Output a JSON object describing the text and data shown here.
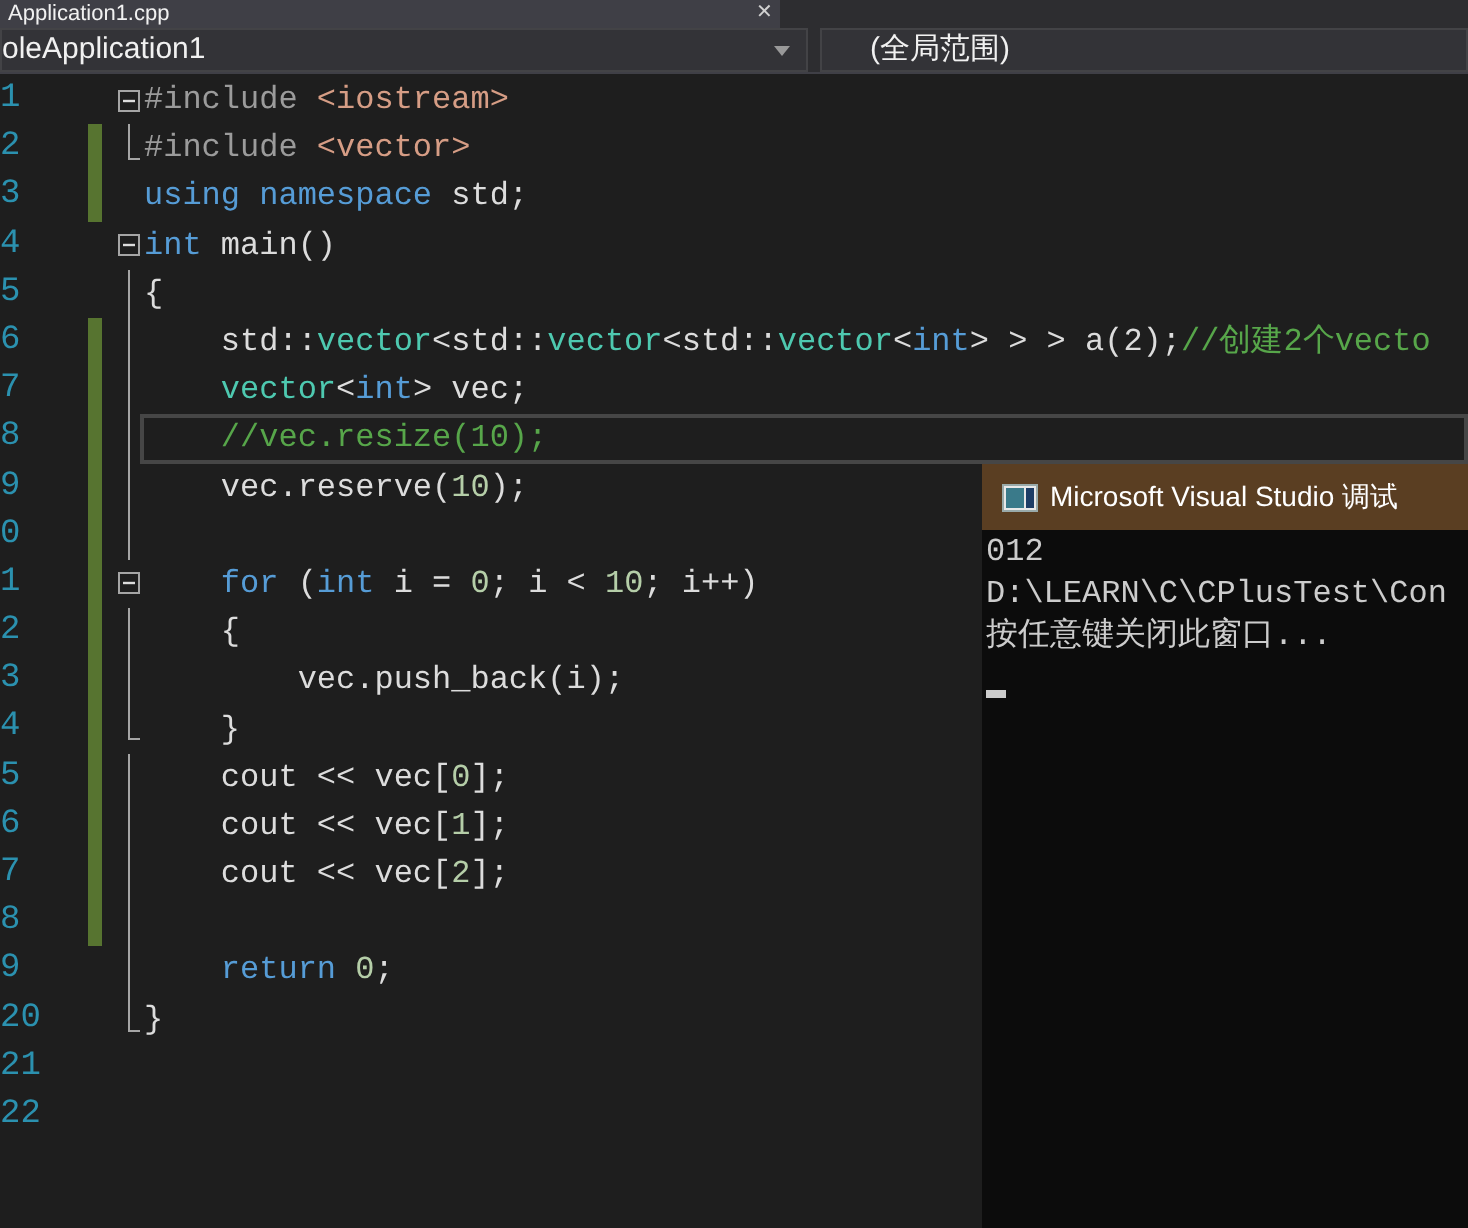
{
  "tab": {
    "title": "Application1.cpp",
    "close": "✕"
  },
  "navigation": {
    "project": "oleApplication1",
    "scope": "(全局范围)"
  },
  "lines": [
    {
      "number": "1",
      "changed": false,
      "current": false,
      "kind": "foldstart",
      "tokens": [
        {
          "t": "#include ",
          "kind": "preproc"
        },
        {
          "t": "<iostream>",
          "kind": "string"
        }
      ]
    },
    {
      "number": "2",
      "changed": true,
      "current": false,
      "kind": "foldend",
      "tokens": [
        {
          "t": "#include ",
          "kind": "preproc"
        },
        {
          "t": "<vector>",
          "kind": "string"
        }
      ]
    },
    {
      "number": "3",
      "changed": true,
      "current": false,
      "kind": "plain",
      "tokens": [
        {
          "t": "using namespace ",
          "kind": "keyword"
        },
        {
          "t": "std;",
          "kind": "plain"
        }
      ]
    },
    {
      "number": "4",
      "changed": false,
      "current": false,
      "kind": "foldstart",
      "tokens": [
        {
          "t": "int ",
          "kind": "keyword"
        },
        {
          "t": "main()",
          "kind": "plain"
        }
      ]
    },
    {
      "number": "5",
      "changed": false,
      "current": false,
      "kind": "foldinner",
      "tokens": [
        {
          "t": "{",
          "kind": "plain"
        }
      ]
    },
    {
      "number": "6",
      "changed": true,
      "current": false,
      "kind": "foldinner",
      "tokens": [
        {
          "t": "    std::",
          "kind": "plain"
        },
        {
          "t": "vector",
          "kind": "type"
        },
        {
          "t": "<std::",
          "kind": "plain"
        },
        {
          "t": "vector",
          "kind": "type"
        },
        {
          "t": "<std::",
          "kind": "plain"
        },
        {
          "t": "vector",
          "kind": "type"
        },
        {
          "t": "<",
          "kind": "plain"
        },
        {
          "t": "int",
          "kind": "keyword"
        },
        {
          "t": "> > > a(2);",
          "kind": "plain"
        },
        {
          "t": "//创建2个vecto",
          "kind": "comment"
        }
      ]
    },
    {
      "number": "7",
      "changed": true,
      "current": false,
      "kind": "foldinner",
      "tokens": [
        {
          "t": "    vector",
          "kind": "type"
        },
        {
          "t": "<",
          "kind": "plain"
        },
        {
          "t": "int",
          "kind": "keyword"
        },
        {
          "t": "> vec;",
          "kind": "plain"
        }
      ]
    },
    {
      "number": "8",
      "changed": true,
      "current": true,
      "kind": "foldinner",
      "tokens": [
        {
          "t": "    //vec.resize(10);",
          "kind": "comment"
        }
      ]
    },
    {
      "number": "9",
      "changed": true,
      "current": false,
      "kind": "foldinner",
      "tokens": [
        {
          "t": "    vec.reserve(",
          "kind": "plain"
        },
        {
          "t": "10",
          "kind": "number"
        },
        {
          "t": ");",
          "kind": "plain"
        }
      ]
    },
    {
      "number": "0",
      "changed": true,
      "current": false,
      "kind": "foldinner"
    },
    {
      "number": "1",
      "changed": true,
      "current": false,
      "kind": "foldstart",
      "tokens": [
        {
          "t": "    for",
          "kind": "keyword"
        },
        {
          "t": " (",
          "kind": "plain"
        },
        {
          "t": "int",
          "kind": "keyword"
        },
        {
          "t": " i = ",
          "kind": "plain"
        },
        {
          "t": "0",
          "kind": "number"
        },
        {
          "t": "; i < ",
          "kind": "plain"
        },
        {
          "t": "10",
          "kind": "number"
        },
        {
          "t": "; i++)",
          "kind": "plain"
        }
      ]
    },
    {
      "number": "2",
      "changed": true,
      "current": false,
      "kind": "foldinner",
      "tokens": [
        {
          "t": "    {",
          "kind": "plain"
        }
      ]
    },
    {
      "number": "3",
      "changed": true,
      "current": false,
      "kind": "foldinner",
      "tokens": [
        {
          "t": "        vec.push_back(i);",
          "kind": "plain"
        }
      ]
    },
    {
      "number": "4",
      "changed": true,
      "current": false,
      "kind": "foldend",
      "tokens": [
        {
          "t": "    }",
          "kind": "plain"
        }
      ]
    },
    {
      "number": "5",
      "changed": true,
      "current": false,
      "kind": "foldinner",
      "tokens": [
        {
          "t": "    cout << vec[",
          "kind": "plain"
        },
        {
          "t": "0",
          "kind": "number"
        },
        {
          "t": "];",
          "kind": "plain"
        }
      ]
    },
    {
      "number": "6",
      "changed": true,
      "current": false,
      "kind": "foldinner",
      "tokens": [
        {
          "t": "    cout << vec[",
          "kind": "plain"
        },
        {
          "t": "1",
          "kind": "number"
        },
        {
          "t": "];",
          "kind": "plain"
        }
      ]
    },
    {
      "number": "7",
      "changed": true,
      "current": false,
      "kind": "foldinner",
      "tokens": [
        {
          "t": "    cout << vec[",
          "kind": "plain"
        },
        {
          "t": "2",
          "kind": "number"
        },
        {
          "t": "];",
          "kind": "plain"
        }
      ]
    },
    {
      "number": "8",
      "changed": true,
      "current": false,
      "kind": "foldinner"
    },
    {
      "number": "9",
      "changed": false,
      "current": false,
      "kind": "foldinner",
      "tokens": [
        {
          "t": "    return ",
          "kind": "keyword"
        },
        {
          "t": "0",
          "kind": "number"
        },
        {
          "t": ";",
          "kind": "plain"
        }
      ]
    },
    {
      "number": "20",
      "changed": false,
      "current": false,
      "kind": "foldend",
      "tokens": [
        {
          "t": "}",
          "kind": "plain"
        }
      ]
    },
    {
      "number": "21",
      "changed": false,
      "current": false,
      "kind": "plain"
    },
    {
      "number": "22",
      "changed": false,
      "current": false,
      "kind": "plain"
    }
  ],
  "console": {
    "title": "Microsoft Visual Studio 调试",
    "output": [
      "012",
      "D:\\LEARN\\C\\CPlusTest\\Con",
      "按任意键关闭此窗口..."
    ],
    "cursor": true
  }
}
